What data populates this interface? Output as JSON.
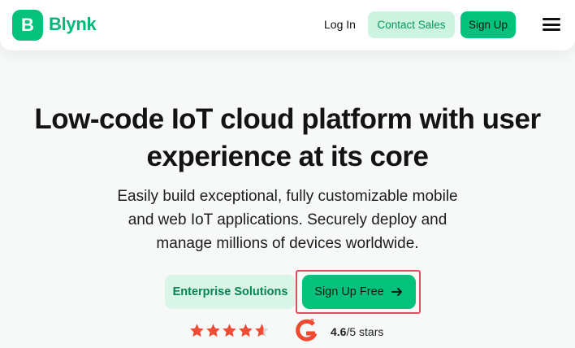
{
  "header": {
    "logo_letter": "B",
    "brand": "Blynk",
    "login_label": "Log In",
    "contact_label": "Contact Sales",
    "signup_label": "Sign Up",
    "menu_icon": "hamburger-menu-icon"
  },
  "hero": {
    "headline_line1": "Low-code IoT cloud platform with user",
    "headline_line2": "experience at its core",
    "sub_line1": "Easily build exceptional, fully customizable mobile",
    "sub_line2": "and web IoT applications. Securely deploy and",
    "sub_line3": "manage millions of devices worldwide.",
    "enterprise_label": "Enterprise Solutions",
    "signup_free_label": "Sign Up Free",
    "arrow_icon": "arrow-right-icon"
  },
  "rating": {
    "stars": 4.6,
    "max_stars": 5,
    "value": "4.6",
    "suffix": "/5 stars",
    "badge_icon": "g2-logo-icon"
  },
  "colors": {
    "brand_green": "#04c27b",
    "light_green": "#cdf3e1",
    "star_red": "#ef4b35",
    "highlight_red": "#e64a5f"
  }
}
